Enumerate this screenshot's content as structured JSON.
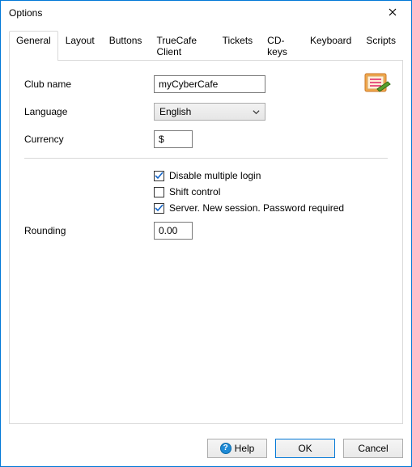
{
  "window": {
    "title": "Options"
  },
  "tabs": [
    {
      "label": "General",
      "active": true
    },
    {
      "label": "Layout"
    },
    {
      "label": "Buttons"
    },
    {
      "label": "TrueCafe Client"
    },
    {
      "label": "Tickets"
    },
    {
      "label": "CD-keys"
    },
    {
      "label": "Keyboard"
    },
    {
      "label": "Scripts"
    }
  ],
  "general": {
    "clubName": {
      "label": "Club name",
      "value": "myCyberCafe"
    },
    "language": {
      "label": "Language",
      "value": "English"
    },
    "currency": {
      "label": "Currency",
      "value": "$"
    },
    "disableMultipleLogin": {
      "label": "Disable multiple login",
      "checked": true
    },
    "shiftControl": {
      "label": "Shift control",
      "checked": false
    },
    "serverNewSessionPassword": {
      "label": "Server. New session. Password required",
      "checked": true
    },
    "rounding": {
      "label": "Rounding",
      "value": "0.00"
    }
  },
  "buttons": {
    "help": "Help",
    "ok": "OK",
    "cancel": "Cancel"
  }
}
